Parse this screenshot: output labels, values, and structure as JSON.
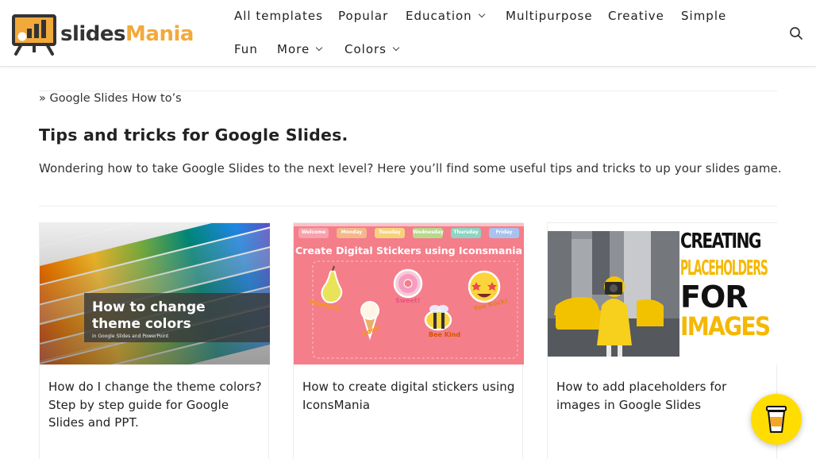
{
  "logo": {
    "part1": "slides",
    "part2": "Mania"
  },
  "nav": {
    "row1": [
      {
        "label": "All templates"
      },
      {
        "label": "Popular"
      },
      {
        "label": "Education"
      },
      {
        "label": "Multipurpose"
      },
      {
        "label": "Creative"
      },
      {
        "label": "Simple"
      }
    ],
    "row2": [
      {
        "label": "Fun"
      },
      {
        "label": "More"
      },
      {
        "label": "Colors"
      }
    ]
  },
  "breadcrumb": "» Google Slides How to’s",
  "page": {
    "title": "Tips and tricks for Google Slides.",
    "description": "Wondering how to take Google Slides to the next level? Here you’ll find some useful tips and tricks to up your slides game."
  },
  "cards": [
    {
      "title": "How do I change the theme colors? Step by step guide for Google Slides and PPT.",
      "image_heading_1": "How to change",
      "image_heading_2": "theme colors",
      "image_subtitle": "in Google Slides and PowerPoint"
    },
    {
      "title": "How to create digital stickers using IconsMania",
      "image_heading": "Create Digital Stickers using Iconsmania",
      "tabs": [
        "Welcome",
        "Monday",
        "Tuesday",
        "Wednesday",
        "Thursday",
        "Friday"
      ],
      "stickers": [
        "Pearfect!",
        "Sweet!",
        "You Rock!",
        "Cool!",
        "Bee Kind"
      ]
    },
    {
      "title": "How to add placeholders for images in Google Slides",
      "image_words": [
        "CREATING",
        "PLACEHOLDERS",
        "FOR",
        "IMAGES"
      ]
    }
  ],
  "colors": {
    "accent": "#f2a93b",
    "card3_heading": "#f5b800",
    "card2_bg": "#f47e8a",
    "buy_me_a_coffee": "#FFDD00"
  }
}
